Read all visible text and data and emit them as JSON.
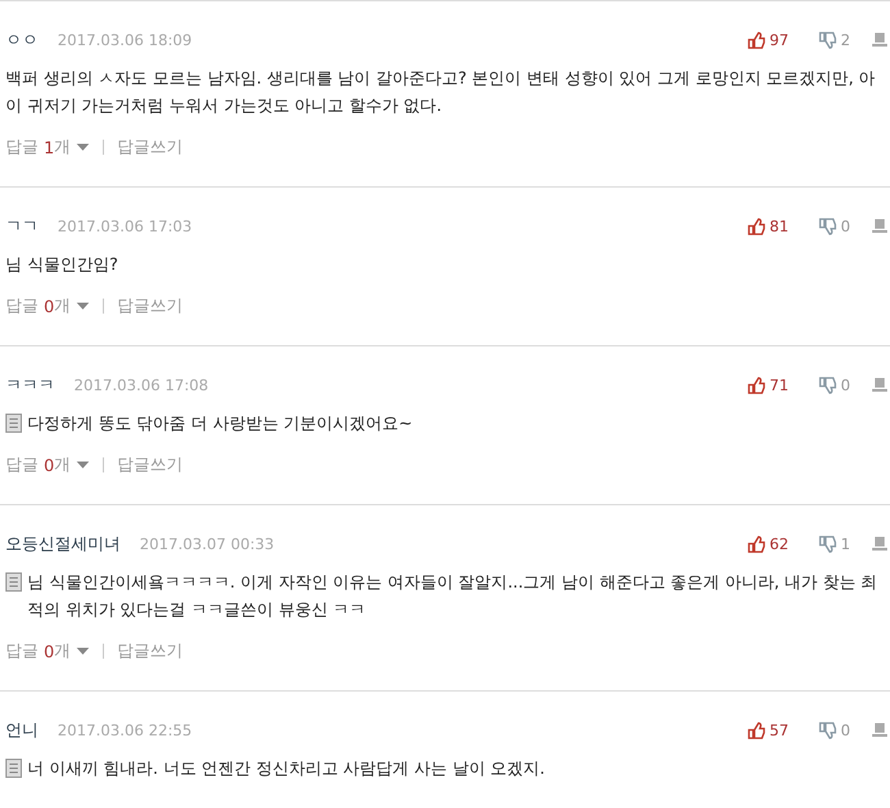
{
  "comments": [
    {
      "author": "ㅇㅇ",
      "date": "2017.03.06 18:09",
      "likes": "97",
      "dislikes": "2",
      "memo": false,
      "text": "백퍼 생리의 ㅅ자도 모르는 남자임. 생리대를 남이 갈아준다고? 본인이 변태 성향이 있어 그게 로망인지 모르겠지만, 아이 귀저기 가는거처럼 누워서 가는것도 아니고 할수가 없다.",
      "reply": {
        "label": "답글",
        "count": "1",
        "unit": "개",
        "write": "답글쓰기"
      }
    },
    {
      "author": "ㄱㄱ",
      "date": "2017.03.06 17:03",
      "likes": "81",
      "dislikes": "0",
      "memo": false,
      "text": "님 식물인간임?",
      "reply": {
        "label": "답글",
        "count": "0",
        "unit": "개",
        "write": "답글쓰기"
      }
    },
    {
      "author": "ㅋㅋㅋ",
      "date": "2017.03.06 17:08",
      "likes": "71",
      "dislikes": "0",
      "memo": true,
      "text": "다정하게 똥도 닦아줌 더 사랑받는 기분이시겠어요~",
      "reply": {
        "label": "답글",
        "count": "0",
        "unit": "개",
        "write": "답글쓰기"
      }
    },
    {
      "author": "오등신절세미녀",
      "date": "2017.03.07 00:33",
      "likes": "62",
      "dislikes": "1",
      "memo": true,
      "text": "님 식물인간이세욬ㅋㅋㅋㅋ. 이게 자작인 이유는 여자들이 잘알지...그게 남이 해준다고 좋은게 아니라, 내가 찾는 최적의 위치가 있다는걸 ㅋㅋ글쓴이 뷰웅신 ㅋㅋ",
      "reply": {
        "label": "답글",
        "count": "0",
        "unit": "개",
        "write": "답글쓰기"
      }
    },
    {
      "author": "언니",
      "date": "2017.03.06 22:55",
      "likes": "57",
      "dislikes": "0",
      "memo": true,
      "text": "너 이새끼 힘내라. 너도 언젠간 정신차리고 사람답게 사는 날이 오겠지."
    }
  ]
}
